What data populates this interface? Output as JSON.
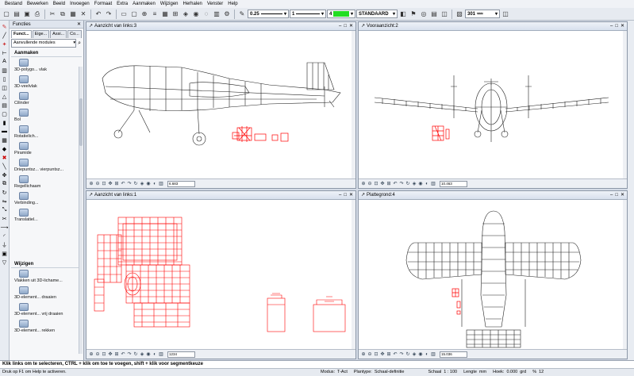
{
  "menu": [
    "Bestand",
    "Bewerken",
    "Beeld",
    "Invoegen",
    "Formaat",
    "Extra",
    "Aanmaken",
    "Wijzigen",
    "Herhalen",
    "Venster",
    "Help"
  ],
  "toolbar": {
    "pen_thickness": "0.25",
    "line_type": "1",
    "color_index": "4",
    "layer": "STANDAARD",
    "pattern": "301"
  },
  "panel": {
    "title": "Functies",
    "tabs": [
      "Funct...",
      "Eige...",
      "Assi...",
      "Co..."
    ],
    "module_select": "Aanvullende modules",
    "section_create": "Aanmaken",
    "section_modify": "Wijzigen",
    "create_tools": [
      "3D-polygo... vlak",
      "3D-veelvlak",
      "Cilinder",
      "Bol",
      "Rotatielich...",
      "Piramide",
      "Driepuntsz... vierpuntsz...",
      "Regellichaam",
      "Verbinding...",
      "Translatiel..."
    ],
    "modify_tools": [
      "Vlakken uit 3D-lichame...",
      "3D-element... draaien",
      "3D-element... vrij draaien",
      "3D-element... rekken"
    ]
  },
  "viewports": [
    {
      "title": "Aanzicht van links:3",
      "zoom": "6.683"
    },
    {
      "title": "Vooraanzicht:2",
      "zoom": "10.463"
    },
    {
      "title": "Aanzicht van links:1",
      "zoom": "1234"
    },
    {
      "title": "Plattegrond:4",
      "zoom": "15.036"
    }
  ],
  "hint": "Klik links om te selecteren, CTRL + klik om toe te voegen, shift + klik voor segmentkeuze",
  "status": {
    "help": "Druk op F1 om Help te activeren.",
    "modus_label": "Modus:",
    "modus_value": "T-Act",
    "plantype_label": "Plantype:",
    "plantype_value": "Schaal-definitie",
    "schaal_label": "Schaal",
    "schaal_value": "1 : 100",
    "lengte_label": "Lengte",
    "lengte_value": "mm",
    "hoek_label": "Hoek:",
    "hoek_value": "0.000",
    "hoek_unit": "grd",
    "percent_label": "%",
    "percent_value": "12"
  },
  "colors": {
    "accent_green": "#22dd22",
    "model_red": "#ff0000"
  }
}
